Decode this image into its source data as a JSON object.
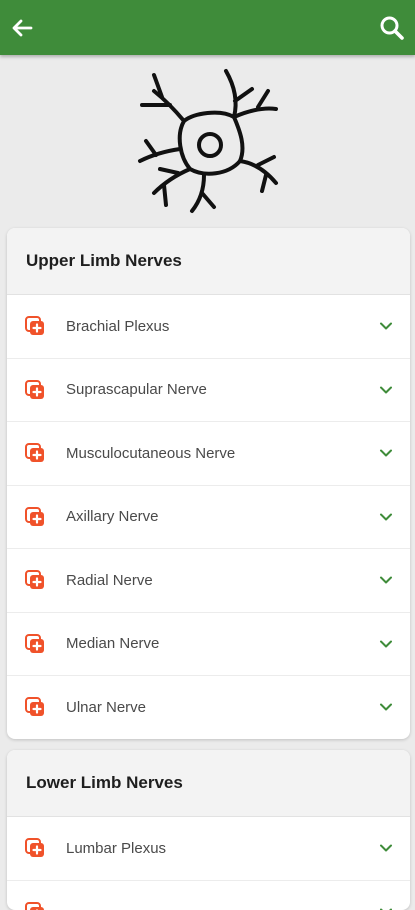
{
  "header": {
    "back_icon": "arrow-left-icon",
    "search_icon": "search-icon",
    "color": "#3f8c3a"
  },
  "hero": {
    "icon": "neuron-icon"
  },
  "sections": [
    {
      "title": "Upper Limb Nerves",
      "items": [
        {
          "label": "Brachial Plexus"
        },
        {
          "label": "Suprascapular Nerve"
        },
        {
          "label": "Musculocutaneous Nerve"
        },
        {
          "label": "Axillary Nerve"
        },
        {
          "label": "Radial Nerve"
        },
        {
          "label": "Median Nerve"
        },
        {
          "label": "Ulnar Nerve"
        }
      ]
    },
    {
      "title": "Lower Limb Nerves",
      "items": [
        {
          "label": "Lumbar Plexus"
        },
        {
          "label": ""
        }
      ]
    }
  ],
  "colors": {
    "item_icon": "#f0522a",
    "chevron": "#3f8c3a"
  }
}
